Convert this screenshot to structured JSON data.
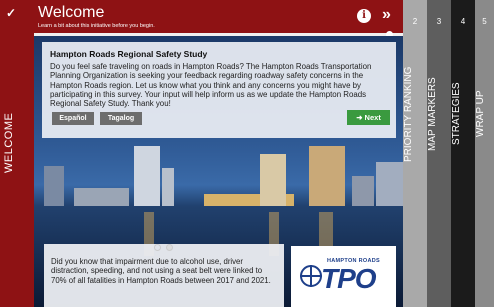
{
  "sidebar": {
    "check_icon": "check-icon",
    "welcome_label": "WELCOME"
  },
  "header": {
    "title": "Welcome",
    "subtitle": "Learn a bit about this initiative before you begin.",
    "info_glyph": "i",
    "next_glyph": "»"
  },
  "intro": {
    "title": "Hampton Roads Regional Safety Study",
    "body": "Do you feel safe traveling on roads in Hampton Roads? The Hampton Roads Transportation Planning Organization is seeking your feedback regarding roadway safety concerns in the Hampton Roads region. Let us know what you think and any concerns you might have by participating in this survey. Your input will help inform us as we update the Hampton Roads Regional Safety Study. Thank you!",
    "lang_espanol": "Español",
    "lang_tagalog": "Tagalog",
    "next_label": "➜ Next"
  },
  "fact": {
    "body": "Did you know that impairment due to alcohol use, driver distraction, speeding, and not using a seat belt were linked to 70% of all fatalities in Hampton Roads between 2017 and 2021."
  },
  "logo": {
    "top": "HAMPTON ROADS",
    "main": "TPO"
  },
  "tabs": [
    {
      "num": "2",
      "label": "PRIORITY RANKING",
      "color": "#a9a9a9"
    },
    {
      "num": "3",
      "label": "MAP MARKERS",
      "color": "#5e5e5e"
    },
    {
      "num": "4",
      "label": "STRATEGIES",
      "color": "#1b1b1b"
    },
    {
      "num": "5",
      "label": "WRAP UP",
      "color": "#8a8a8a"
    }
  ],
  "colors": {
    "accent": "#8e1214",
    "next_button": "#3a9a3f",
    "logo_blue": "#1e3f8a"
  }
}
